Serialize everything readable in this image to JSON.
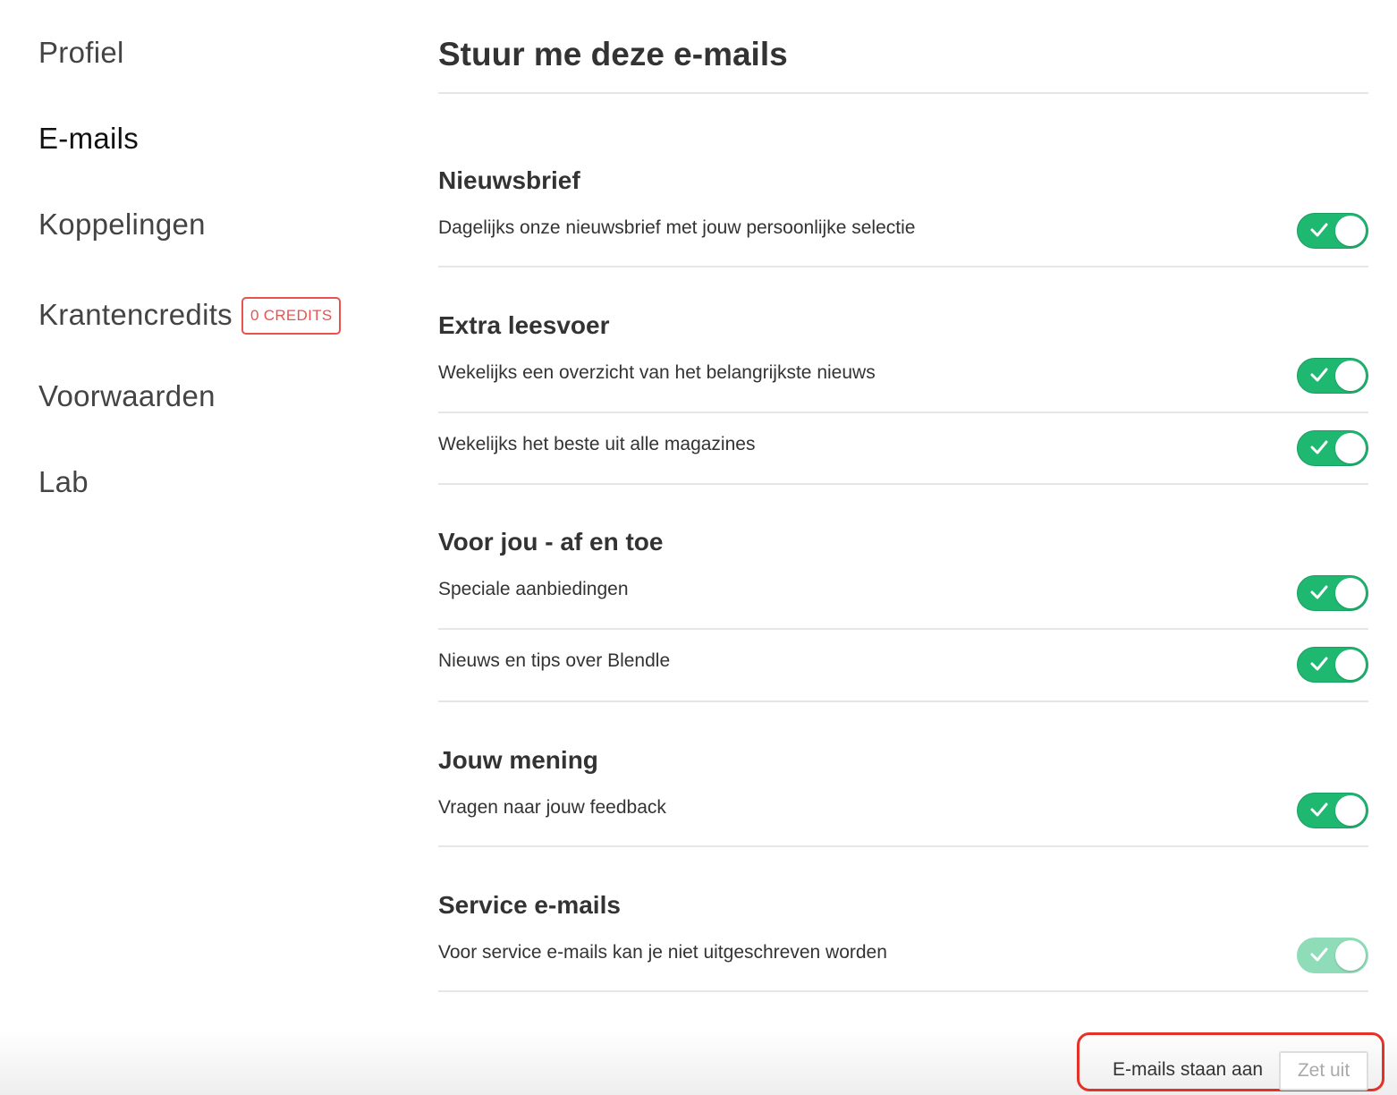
{
  "sidebar": {
    "items": [
      {
        "label": "Profiel",
        "active": false
      },
      {
        "label": "E-mails",
        "active": true
      },
      {
        "label": "Koppelingen",
        "active": false
      },
      {
        "label": "Krantencredits",
        "active": false,
        "badge": "0 CREDITS"
      },
      {
        "label": "Voorwaarden",
        "active": false
      },
      {
        "label": "Lab",
        "active": false
      }
    ]
  },
  "main": {
    "title": "Stuur me deze e-mails",
    "sections": [
      {
        "title": "Nieuwsbrief",
        "rows": [
          {
            "label": "Dagelijks onze nieuwsbrief met jouw persoonlijke selectie",
            "enabled": true,
            "disabled": false
          }
        ]
      },
      {
        "title": "Extra leesvoer",
        "rows": [
          {
            "label": "Wekelijks een overzicht van het belangrijkste nieuws",
            "enabled": true,
            "disabled": false
          },
          {
            "label": "Wekelijks het beste uit alle magazines",
            "enabled": true,
            "disabled": false
          }
        ]
      },
      {
        "title": "Voor jou - af en toe",
        "rows": [
          {
            "label": "Speciale aanbiedingen",
            "enabled": true,
            "disabled": false
          },
          {
            "label": "Nieuws en tips over Blendle",
            "enabled": true,
            "disabled": false
          }
        ]
      },
      {
        "title": "Jouw mening",
        "rows": [
          {
            "label": "Vragen naar jouw feedback",
            "enabled": true,
            "disabled": false
          }
        ]
      },
      {
        "title": "Service e-mails",
        "rows": [
          {
            "label": "Voor service e-mails kan je niet uitgeschreven worden",
            "enabled": true,
            "disabled": true
          }
        ]
      }
    ]
  },
  "footer": {
    "status": "E-mails staan aan",
    "button_label": "Zet uit"
  },
  "colors": {
    "toggle_on": "#1fb871",
    "toggle_disabled": "#8fdcb8",
    "badge": "#e8534f",
    "highlight_box": "#e53228"
  },
  "icons": {
    "toggle_check": "check-icon"
  }
}
